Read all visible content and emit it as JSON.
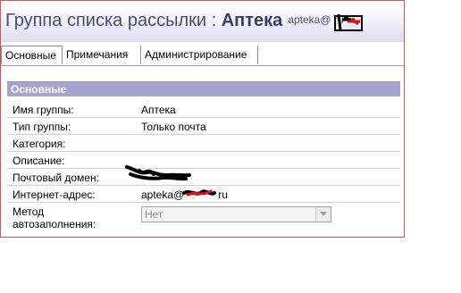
{
  "header": {
    "title_prefix": "Группа списка рассылки : ",
    "group_name": "Аптека",
    "email": "apteka@ ru"
  },
  "tabs": [
    {
      "label": "Основные",
      "active": true
    },
    {
      "label": "Примечания",
      "active": false
    },
    {
      "label": "Администрирование",
      "active": false
    }
  ],
  "section": {
    "title": "Основные"
  },
  "fields": {
    "name": {
      "label": "Имя группы:",
      "value": "Аптека"
    },
    "type": {
      "label": "Тип группы:",
      "value": "Только почта"
    },
    "category": {
      "label": "Категория:",
      "value": ""
    },
    "description": {
      "label": "Описание:",
      "value": ""
    },
    "mail_domain": {
      "label": "Почтовый домен:",
      "value": ""
    },
    "internet_address": {
      "label": "Интернет-адрес:",
      "value_prefix": "apteka@",
      "value_suffix": "ru"
    },
    "autofill": {
      "label_line1": "Метод",
      "label_line2": "автозаполнения:",
      "selected": "Нет"
    }
  },
  "colors": {
    "header_text": "#4a4a7a",
    "section_bar": "#a3a5cc",
    "frame_border": "#c85a5a"
  }
}
